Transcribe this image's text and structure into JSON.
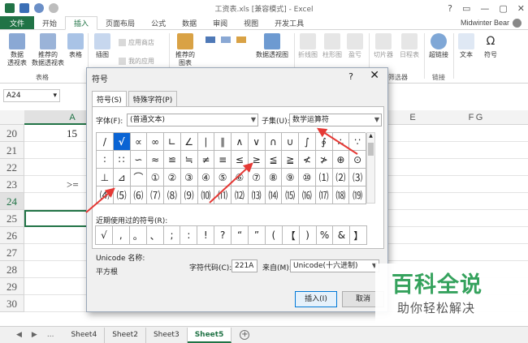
{
  "window": {
    "title": "工资表.xls [兼容模式] - Excel",
    "controls": [
      "?",
      "▭",
      "—",
      "▢",
      "✕"
    ]
  },
  "ribbon_tabs": [
    "文件",
    "开始",
    "插入",
    "页面布局",
    "公式",
    "数据",
    "审阅",
    "视图",
    "开发工具"
  ],
  "user": "Midwinter Bear",
  "ribbon": {
    "pivot": "数据\n透视表",
    "recommended_pivot": "推荐的\n数据透视表",
    "table": "表格",
    "group_tables": "表格",
    "illustrations": "插图",
    "app_store": "应用商店",
    "my_apps": "我的应用",
    "recommended_charts": "推荐的\n图表",
    "pivot_chart": "数据透视图",
    "line": "折线图",
    "column": "柱形图",
    "winloss": "盈亏",
    "slicer": "切片器",
    "timeline": "日程表",
    "group_filter": "筛选器",
    "hyperlink": "超链接",
    "group_links": "链接",
    "text": "文本",
    "symbol": "符号"
  },
  "formula_bar": {
    "namebox": "A24"
  },
  "columns": [
    "A",
    "E",
    "F",
    "G"
  ],
  "rows": [
    {
      "num": "20",
      "a": "15"
    },
    {
      "num": "21",
      "a": ""
    },
    {
      "num": "22",
      "a": ""
    },
    {
      "num": "23",
      "a": ">="
    },
    {
      "num": "24",
      "a": ""
    },
    {
      "num": "25",
      "a": ""
    },
    {
      "num": "26",
      "a": ""
    },
    {
      "num": "27",
      "a": ""
    },
    {
      "num": "28",
      "a": ""
    },
    {
      "num": "29",
      "a": ""
    },
    {
      "num": "30",
      "a": ""
    }
  ],
  "sheets": [
    "Sheet4",
    "Sheet2",
    "Sheet3",
    "Sheet5"
  ],
  "active_sheet": "Sheet5",
  "sheet_nav": [
    "◀",
    "▶",
    "..."
  ],
  "dialog": {
    "title": "符号",
    "help": "?",
    "close": "✕",
    "tabs": [
      "符号(S)",
      "特殊字符(P)"
    ],
    "font_label": "字体(F):",
    "font_value": "(普通文本)",
    "subset_label": "子集(U):",
    "subset_value": "数学运算符",
    "symbols": [
      "/",
      "√",
      "∝",
      "∞",
      "∟",
      "∠",
      "∣",
      "∥",
      "∧",
      "∨",
      "∩",
      "∪",
      "∫",
      "∮",
      "∴",
      "∵",
      "∶",
      "∷",
      "∽",
      "≈",
      "≌",
      "≒",
      "≠",
      "≡",
      "≤",
      "≥",
      "≦",
      "≧",
      "≮",
      "≯",
      "⊕",
      "⊙",
      "⊥",
      "⊿",
      "⌒",
      "①",
      "②",
      "③",
      "④",
      "⑤",
      "⑥",
      "⑦",
      "⑧",
      "⑨",
      "⑩",
      "⑴",
      "⑵",
      "⑶",
      "⑷",
      "⑸",
      "⑹",
      "⑺",
      "⑻",
      "⑼",
      "⑽",
      "⑾",
      "⑿",
      "⒀",
      "⒁",
      "⒂",
      "⒃",
      "⒄",
      "⒅",
      "⒆"
    ],
    "selected_symbol_index": 1,
    "recent_label": "近期使用过的符号(R):",
    "recent": [
      "√",
      ",",
      "。",
      "、",
      ";",
      ":",
      "!",
      "?",
      "“",
      "”",
      "(",
      "【",
      ")",
      "%",
      "&",
      "】"
    ],
    "unicode_name_label": "Unicode 名称:",
    "unicode_name": "平方根",
    "char_code_label": "字符代码(C):",
    "char_code": "221A",
    "from_label": "来自(M):",
    "from_value": "Unicode(十六进制)",
    "insert": "插入(I)",
    "cancel": "取消"
  },
  "watermark": {
    "title": "百科全说",
    "subtitle": "助你轻松解决"
  },
  "colors": {
    "excel_green": "#217346",
    "selection_blue": "#0a64d4",
    "arrow_red": "#e53935",
    "watermark_green": "#35a25d"
  }
}
